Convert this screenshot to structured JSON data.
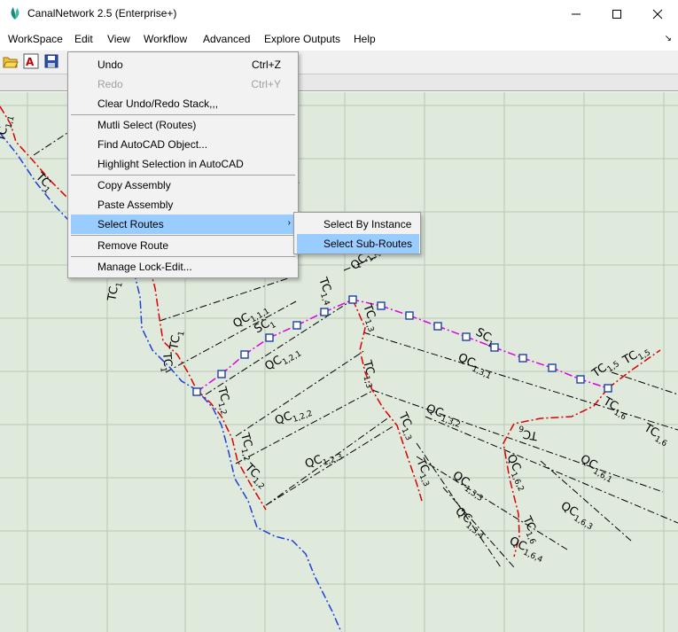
{
  "window": {
    "title": "CanalNetwork 2.5  (Enterprise+)",
    "icon": "leaf-icon",
    "controls": [
      "minimize",
      "maximize",
      "close"
    ]
  },
  "menubar": {
    "items": [
      "WorkSpace",
      "Edit",
      "View",
      "Workflow",
      "Advanced",
      "Explore Outputs",
      "Help"
    ],
    "extra": "↘"
  },
  "toolbar": {
    "icons": [
      "open-folder-icon",
      "text-style-icon",
      "save-icon"
    ]
  },
  "edit_menu": {
    "items": [
      {
        "label": "Undo",
        "shortcut": "Ctrl+Z",
        "enabled": true
      },
      {
        "label": "Redo",
        "shortcut": "Ctrl+Y",
        "enabled": false
      },
      {
        "label": "Clear Undo/Redo Stack,,,",
        "shortcut": "",
        "enabled": true
      },
      {
        "label": "Mutli Select (Routes)",
        "shortcut": "",
        "enabled": true
      },
      {
        "label": "Find AutoCAD Object...",
        "shortcut": "",
        "enabled": true
      },
      {
        "label": "Highlight Selection in AutoCAD",
        "shortcut": "",
        "enabled": true
      },
      {
        "label": "Copy Assembly",
        "shortcut": "",
        "enabled": true
      },
      {
        "label": "Paste Assembly",
        "shortcut": "",
        "enabled": true
      },
      {
        "label": "Select Routes",
        "shortcut": "",
        "enabled": true,
        "submenu": true,
        "highlighted": true
      },
      {
        "label": "Remove Route",
        "shortcut": "",
        "enabled": true
      },
      {
        "label": "Manage Lock-Edit...",
        "shortcut": "",
        "enabled": true
      }
    ],
    "submenu_arrow": "›"
  },
  "select_routes_submenu": {
    "items": [
      {
        "label": "Select By Instance",
        "highlighted": false
      },
      {
        "label": "Select Sub-Routes",
        "highlighted": true
      }
    ]
  },
  "drawing": {
    "background": "#dfeadd",
    "colors": {
      "tc_line": "#dd0000",
      "sc_line": "#e000e0",
      "blue_line": "#1f3fd8",
      "qc_line": "#000000",
      "grid": "#b8c8b4"
    },
    "labels": [
      {
        "main": "TC",
        "sub": "1,1"
      },
      {
        "main": "TC",
        "sub": "1"
      },
      {
        "main": "TC",
        "sub": "1"
      },
      {
        "main": "QC",
        "sub": "1,4"
      },
      {
        "main": "TC",
        "sub": "1,4"
      },
      {
        "main": "QC",
        "sub": "1,1,1"
      },
      {
        "main": "SC",
        "sub": "1"
      },
      {
        "main": "TC",
        "sub": "1,3"
      },
      {
        "main": "SC",
        "sub": "1"
      },
      {
        "main": "TC",
        "sub": "1,5"
      },
      {
        "main": "TC",
        "sub": "1,5"
      },
      {
        "main": "QC",
        "sub": "1,2,1"
      },
      {
        "main": "QC",
        "sub": "1,3,1"
      },
      {
        "main": "TC",
        "sub": "1,3"
      },
      {
        "main": "TC",
        "sub": "1,2"
      },
      {
        "main": "QC",
        "sub": "1,2,2"
      },
      {
        "main": "QC",
        "sub": "1,3,2"
      },
      {
        "main": "TC",
        "sub": "1,3"
      },
      {
        "main": "TC",
        "sub": "1,6"
      },
      {
        "main": "TC",
        "sub": "6"
      },
      {
        "main": "QC",
        "sub": "1,6,1"
      },
      {
        "main": "TC",
        "sub": "1,2"
      },
      {
        "main": "TC",
        "sub": "1,2"
      },
      {
        "main": "QC",
        "sub": "1,2,3"
      },
      {
        "main": "TC",
        "sub": "1,3"
      },
      {
        "main": "QC",
        "sub": "1,6,2"
      },
      {
        "main": "TC",
        "sub": "1,6"
      },
      {
        "main": "QC",
        "sub": "1,3,3"
      },
      {
        "main": "QC",
        "sub": "1,6,3"
      },
      {
        "main": "QC",
        "sub": "1,3,4"
      },
      {
        "main": "TC",
        "sub": "1,6"
      },
      {
        "main": "QC",
        "sub": "1,6,4"
      },
      {
        "main": "TC",
        "sub": "1"
      },
      {
        "main": "TC",
        "sub": "1"
      },
      {
        "main": "QC",
        "sub": "1"
      }
    ]
  }
}
